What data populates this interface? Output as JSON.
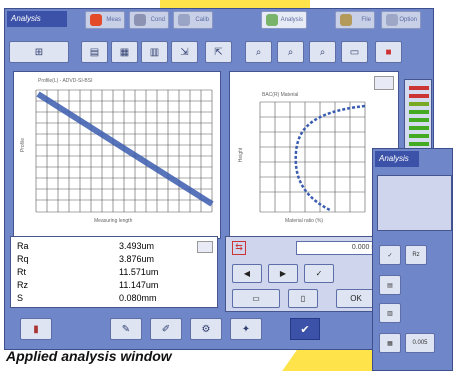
{
  "window": {
    "title": "Analysis",
    "tabs": [
      {
        "label": "Meas",
        "icon": "measure-icon"
      },
      {
        "label": "Cond",
        "icon": "condition-icon"
      },
      {
        "label": "Calib",
        "icon": "calibrate-icon"
      },
      {
        "label": "Analysis",
        "icon": "analysis-icon"
      },
      {
        "label": "File",
        "icon": "file-icon"
      },
      {
        "label": "Option",
        "icon": "option-icon"
      }
    ]
  },
  "toolbar": {
    "icons": [
      "grid-icon",
      "print-icon",
      "table-icon",
      "graph-icon",
      "export-icon",
      "import-icon",
      "zoom-icon",
      "zoom-in-icon",
      "zoom-out-icon",
      "fit-icon",
      "stop-icon"
    ]
  },
  "charts": {
    "left": {
      "title": "Profile(L) - ADVD-SI-BSI",
      "xlabel": "Measuring length",
      "ylabel": "Profile"
    },
    "right": {
      "title": "BAC(R) Material",
      "xlabel": "Material ratio (%)",
      "ylabel": "Height"
    }
  },
  "results": {
    "rows": [
      {
        "name": "Ra",
        "value": "3.493um"
      },
      {
        "name": "Rq",
        "value": "3.876um"
      },
      {
        "name": "Rt",
        "value": "11.571um"
      },
      {
        "name": "Rz",
        "value": "11.147um"
      },
      {
        "name": "S",
        "value": "0.080mm"
      }
    ]
  },
  "controls": {
    "field_value": "0.000 mm",
    "buttons": [
      "◀",
      "▶",
      "✓",
      "OK"
    ],
    "ok_label": "OK"
  },
  "window2": {
    "title": "Analysis",
    "buttons": [
      "Rz",
      "0.005"
    ]
  },
  "caption": "Applied analysis window",
  "colors": {
    "accent": "#3b52a8",
    "window": "#6f86c8",
    "highlight": "#ffe34a"
  }
}
